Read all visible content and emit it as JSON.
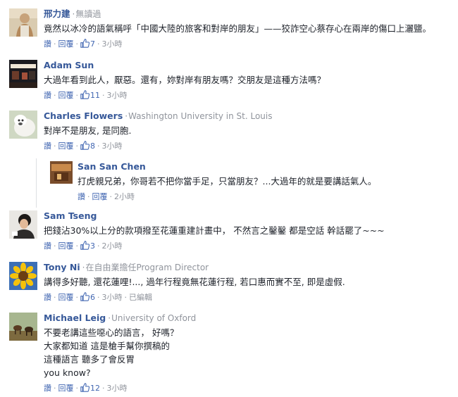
{
  "labels": {
    "like": "讚",
    "reply": "回覆",
    "dot": "·",
    "sep": "·"
  },
  "colors": {
    "name": "#365899",
    "link": "#4267b2",
    "meta": "#90949c",
    "text": "#1d2129",
    "divider": "#dddfe2"
  },
  "comments": [
    {
      "name": "邢力建",
      "meta": "無讀過",
      "lines": [
        "竟然以冰冷的語氣稱呼「中國大陸的旅客和對岸的朋友」——狡詐空心蔡存心在兩岸的傷口上灑鹽。"
      ],
      "likes": "7",
      "time": "3小時",
      "avatar_icon": "portrait-photo"
    },
    {
      "name": "Adam Sun",
      "meta": "",
      "lines": [
        "大過年看到此人，厭惡。還有，妳對岸有朋友嗎？交朋友是這種方法嗎？"
      ],
      "likes": "11",
      "time": "3小時",
      "avatar_icon": "storefront-photo"
    },
    {
      "name": "Charles Flowers",
      "meta": "Washington University in St. Louis",
      "lines": [
        "對岸不是朋友, 是同胞."
      ],
      "likes": "8",
      "time": "3小時",
      "avatar_icon": "dog-photo"
    },
    {
      "name": "San San Chen",
      "meta": "",
      "lines": [
        "打虎親兄弟，你哥若不把你當手足，只當朋友？...大過年的就是要講話氣人。"
      ],
      "likes": "",
      "time": "2小時",
      "avatar_icon": "room-photo"
    },
    {
      "name": "Sam Tseng",
      "meta": "",
      "lines": [
        "把錢沾30%以上分的款項撥至花蓮重建計畫中， 不然言之鑿鑿 都是空話 幹話罷了~~~"
      ],
      "likes": "3",
      "time": "2小時",
      "avatar_icon": "person-photo"
    },
    {
      "name": "Tony Ni",
      "meta": "在自由業擔任Program Director",
      "lines": [
        "講得多好聽, 還花蓮哩!..., 過年行程竟無花蓮行程, 若口惠而實不至, 即是虛假."
      ],
      "likes": "6",
      "time": "3小時",
      "edited": "已編輯",
      "avatar_icon": "sunflower-photo"
    },
    {
      "name": "Michael Leig",
      "meta": "University of Oxford",
      "lines": [
        "不要老講這些噁心的語言， 好嗎？",
        "大家都知道 這是槍手幫你撰稿的",
        "這種語言 聽多了會反胃",
        "you know?"
      ],
      "likes": "12",
      "time": "3小時",
      "avatar_icon": "horses-photo"
    }
  ]
}
